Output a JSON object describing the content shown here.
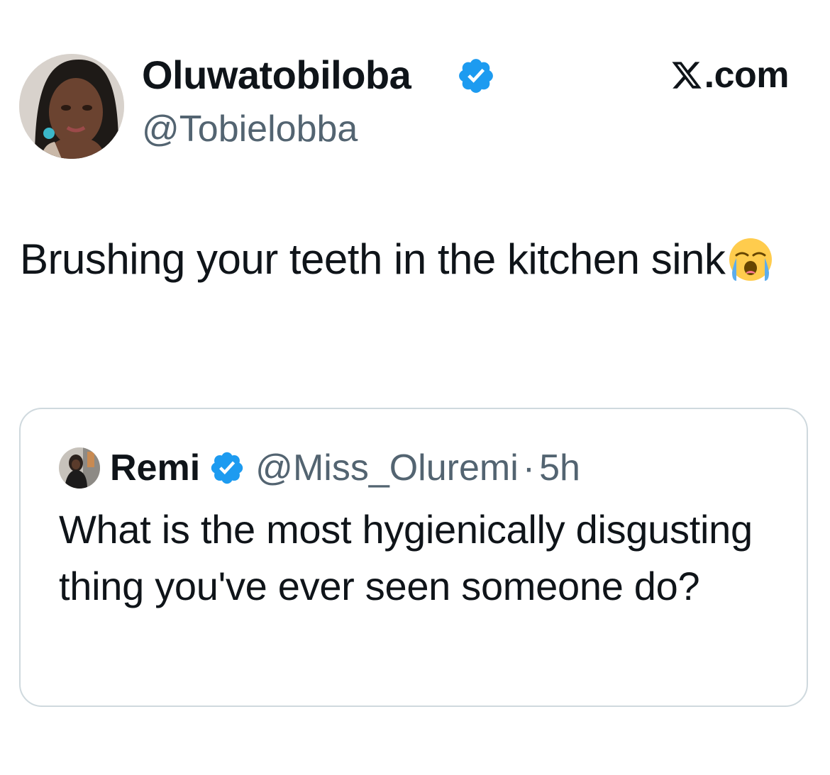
{
  "tweet": {
    "display_name": "Oluwatobiloba",
    "handle": "@Tobielobba",
    "text": "Brushing your teeth in the kitchen sink",
    "emoji": "loudly-crying-face",
    "avatar": "user-avatar-photo",
    "verified_icon": "verified-badge-icon"
  },
  "brand": {
    "logo_icon": "x-logo-icon",
    "suffix": ".com"
  },
  "quote": {
    "display_name": "Remi",
    "handle": "@Miss_Oluremi",
    "separator": "·",
    "time": "5h",
    "text": "What is the most hygienically disgusting thing you've ever seen someone do?",
    "avatar": "quoted-user-avatar-photo",
    "verified_icon": "verified-badge-icon"
  },
  "colors": {
    "text_primary": "#0f1419",
    "text_secondary": "#536471",
    "verified_blue": "#1d9bf0",
    "card_border": "#cfd9de",
    "background": "#ffffff"
  }
}
